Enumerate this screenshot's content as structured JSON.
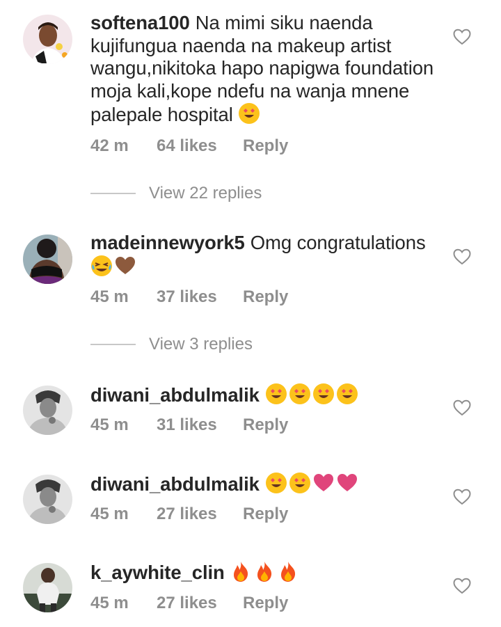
{
  "comments": [
    {
      "username": "softena100",
      "text": "Na mimi siku naenda kujifungua naenda na makeup artist wangu,nikitoka hapo napigwa foundation moja kali,kope ndefu na wanja mnene palepale hospital",
      "emojis": [
        "heart-eyes"
      ],
      "time": "42 m",
      "likes": "64 likes",
      "reply_label": "Reply",
      "view_replies": "View 22 replies"
    },
    {
      "username": "madeinnewyork5",
      "text": "Omg congratulations",
      "emojis": [
        "tears-of-joy",
        "brown-heart"
      ],
      "time": "45 m",
      "likes": "37 likes",
      "reply_label": "Reply",
      "view_replies": "View 3 replies"
    },
    {
      "username": "diwani_abdulmalik",
      "text": "",
      "emojis": [
        "heart-eyes",
        "heart-eyes",
        "heart-eyes",
        "heart-eyes"
      ],
      "time": "45 m",
      "likes": "31 likes",
      "reply_label": "Reply"
    },
    {
      "username": "diwani_abdulmalik",
      "text": "",
      "emojis": [
        "heart-eyes",
        "heart-eyes",
        "pink-heart",
        "pink-heart"
      ],
      "time": "45 m",
      "likes": "27 likes",
      "reply_label": "Reply"
    },
    {
      "username": "k_aywhite_clin",
      "text": "",
      "emojis": [
        "fire",
        "fire",
        "fire"
      ],
      "time": "45 m",
      "likes": "27 likes",
      "reply_label": "Reply"
    }
  ],
  "icons": {
    "like": "heart-outline-icon"
  },
  "colors": {
    "text": "#262626",
    "meta": "#8e8e8e",
    "divider": "#c7c7c7"
  }
}
